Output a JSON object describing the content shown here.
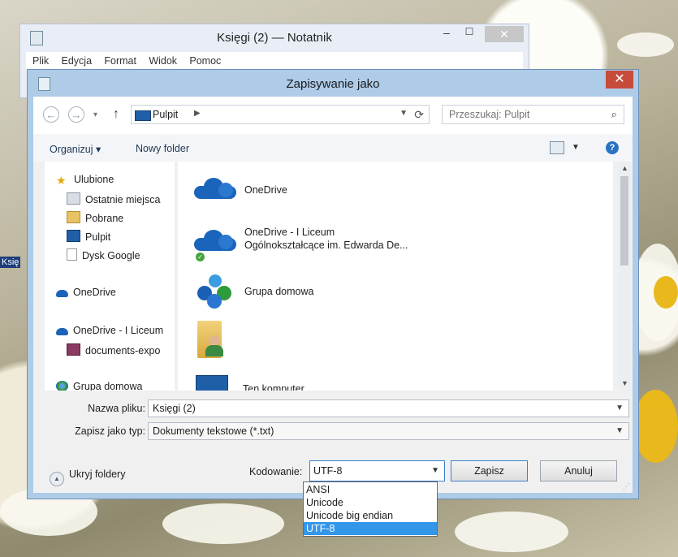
{
  "notepad": {
    "title": "Księgi (2) — Notatnik",
    "menu": [
      "Plik",
      "Edycja",
      "Format",
      "Widok",
      "Pomoc"
    ],
    "desktop_label": "Księ"
  },
  "dialog": {
    "title": "Zapisywanie jako",
    "address": {
      "location": "Pulpit"
    },
    "search": {
      "placeholder": "Przeszukaj: Pulpit"
    },
    "toolbar": {
      "organize": "Organizuj ▾",
      "new_folder": "Nowy folder"
    },
    "nav": [
      {
        "label": "Ulubione",
        "icon": "star-icon"
      },
      {
        "label": "Ostatnie miejsca",
        "icon": "recent-places-icon"
      },
      {
        "label": "Pobrane",
        "icon": "downloads-folder-icon"
      },
      {
        "label": "Pulpit",
        "icon": "desktop-icon"
      },
      {
        "label": "Dysk Google",
        "icon": "document-icon"
      },
      {
        "label": "OneDrive",
        "icon": "onedrive-cloud-icon"
      },
      {
        "label": "OneDrive - I Liceum",
        "icon": "onedrive-cloud-icon"
      },
      {
        "label": "documents-expo",
        "icon": "archive-icon"
      },
      {
        "label": "Grupa domowa",
        "icon": "homegroup-icon"
      }
    ],
    "items": [
      {
        "name": "OneDrive",
        "sub": ""
      },
      {
        "name": "OneDrive - I Liceum",
        "sub": "Ogólnokształcące im. Edwarda De..."
      },
      {
        "name": "Grupa domowa",
        "sub": ""
      },
      {
        "name": "",
        "sub": ""
      },
      {
        "name": "Ten komputer",
        "sub": ""
      }
    ],
    "filename": {
      "label": "Nazwa pliku:",
      "value": "Księgi (2)"
    },
    "filetype": {
      "label": "Zapisz jako typ:",
      "value": "Dokumenty tekstowe (*.txt)"
    },
    "hide_folders": "Ukryj foldery",
    "encoding": {
      "label": "Kodowanie:",
      "value": "UTF-8",
      "options": [
        "ANSI",
        "Unicode",
        "Unicode big endian",
        "UTF-8"
      ],
      "selected": "UTF-8"
    },
    "save_label": "Zapisz",
    "cancel_label": "Anuluj",
    "close_glyph": "✕"
  }
}
